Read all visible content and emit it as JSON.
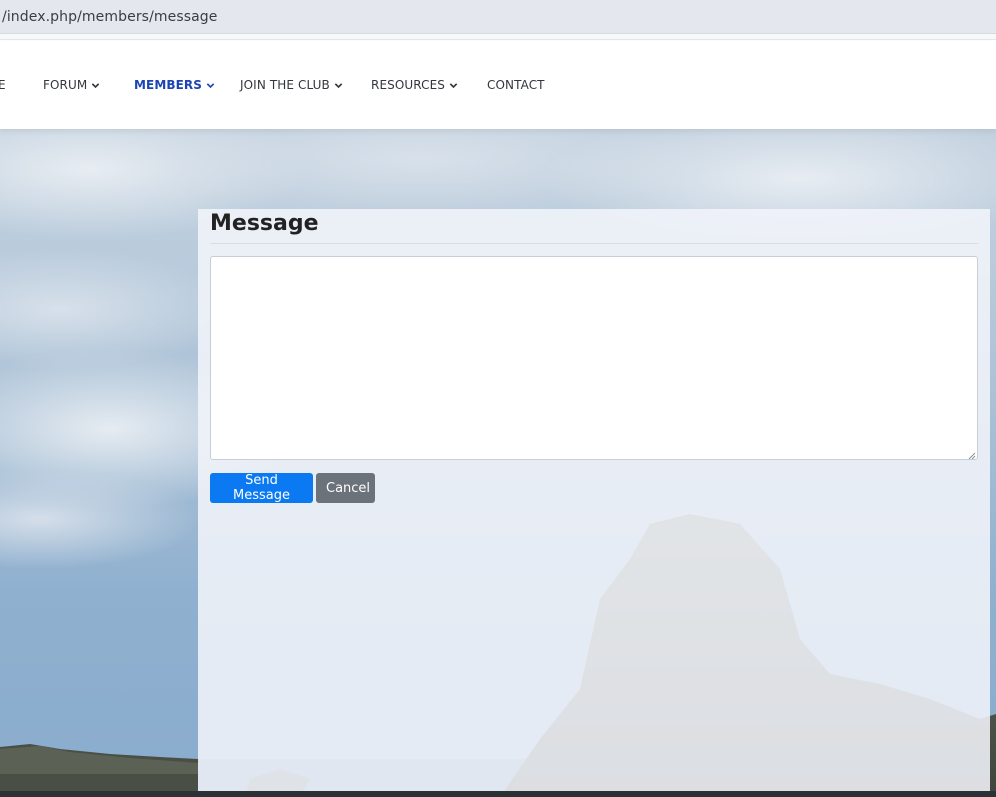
{
  "browser": {
    "url": "/index.php/members/message"
  },
  "nav": {
    "items": [
      {
        "label": "E",
        "chevron": false,
        "active": false
      },
      {
        "label": "FORUM",
        "chevron": true,
        "active": false
      },
      {
        "label": "MEMBERS",
        "chevron": true,
        "active": true
      },
      {
        "label": "JOIN THE CLUB",
        "chevron": true,
        "active": false
      },
      {
        "label": "RESOURCES",
        "chevron": true,
        "active": false
      },
      {
        "label": "CONTACT",
        "chevron": false,
        "active": false
      }
    ]
  },
  "message": {
    "title": "Message",
    "textarea_value": "",
    "send_label": "Send Message",
    "cancel_label": "Cancel"
  },
  "colors": {
    "nav_active": "#1c45b3",
    "primary_button": "#0b7af2",
    "secondary_button": "#6b727a"
  }
}
